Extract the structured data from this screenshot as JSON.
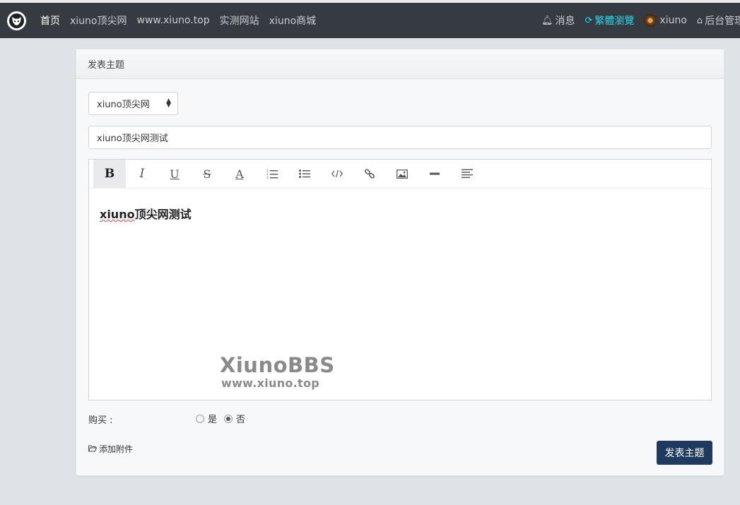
{
  "nav": {
    "left": [
      {
        "label": "首页",
        "active": true
      },
      {
        "label": "xiuno顶尖网",
        "active": false
      },
      {
        "label": "www.xiuno.top",
        "active": false
      },
      {
        "label": "实测网站",
        "active": false
      },
      {
        "label": "xiuno商城",
        "active": false
      }
    ],
    "right": {
      "messages": "消息",
      "traditional": "繁體瀏覽",
      "user": "xiuno",
      "admin": "后台管理"
    }
  },
  "card": {
    "header": "发表主题",
    "forum_select": "xiuno顶尖网",
    "title_value": "xiuno顶尖网测试",
    "editor": {
      "content_en": "xiuno",
      "content_cn": "顶尖网测试"
    },
    "watermark": {
      "line1": "XiunoBBS",
      "line2": "www.xiuno.top"
    },
    "buy": {
      "label": "购买 :",
      "yes": "是",
      "no": "否",
      "selected": "否"
    },
    "attach_label": "添加附件",
    "submit_label": "发表主题"
  },
  "colors": {
    "topbar": "#363b42",
    "accent_cyan": "#20d7ec",
    "submit": "#1e3a5f"
  }
}
